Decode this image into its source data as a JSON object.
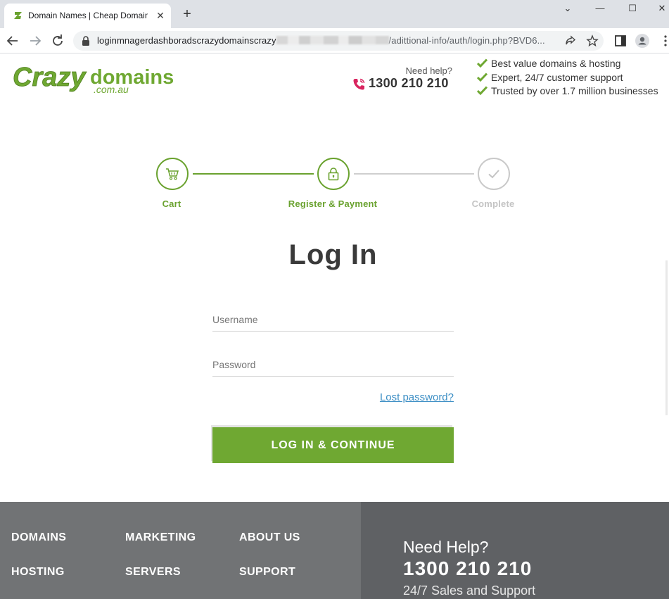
{
  "browser": {
    "tab_title": "Domain Names | Cheap Domain",
    "new_tab_label": "+",
    "url_prefix": "loginmnagerdashboradscrazydomainscrazy",
    "url_suffix": "/adittional-info/auth/login.php?BVD6...",
    "icons": [
      "back-arrow-icon",
      "forward-arrow-icon",
      "reload-icon",
      "lock-icon",
      "share-icon",
      "star-icon",
      "side-panel-icon",
      "profile-icon",
      "menu-kebab-icon"
    ]
  },
  "header": {
    "logo_main": "Crazy",
    "logo_sub": "domains",
    "logo_tld": ".com.au",
    "need_help": "Need help?",
    "phone": "1300 210 210",
    "usps": [
      "Best value domains & hosting",
      "Expert, 24/7 customer support",
      "Trusted by over 1.7 million businesses"
    ]
  },
  "steps": [
    {
      "label": "Cart",
      "state": "done"
    },
    {
      "label": "Register & Payment",
      "state": "active"
    },
    {
      "label": "Complete",
      "state": "pending"
    }
  ],
  "login": {
    "title": "Log In",
    "username_placeholder": "Username",
    "password_placeholder": "Password",
    "lost_password": "Lost password?",
    "submit_label": "LOG IN & CONTINUE"
  },
  "footer": {
    "links": [
      "DOMAINS",
      "MARKETING",
      "ABOUT US",
      "HOSTING",
      "SERVERS",
      "SUPPORT"
    ],
    "help_title": "Need Help?",
    "help_phone": "1300 210 210",
    "help_sub": "24/7 Sales and Support"
  },
  "colors": {
    "brand_green": "#6fa832",
    "link_blue": "#3d8fc5",
    "phone_pink": "#d9245f",
    "footer_grey": "#717375"
  }
}
